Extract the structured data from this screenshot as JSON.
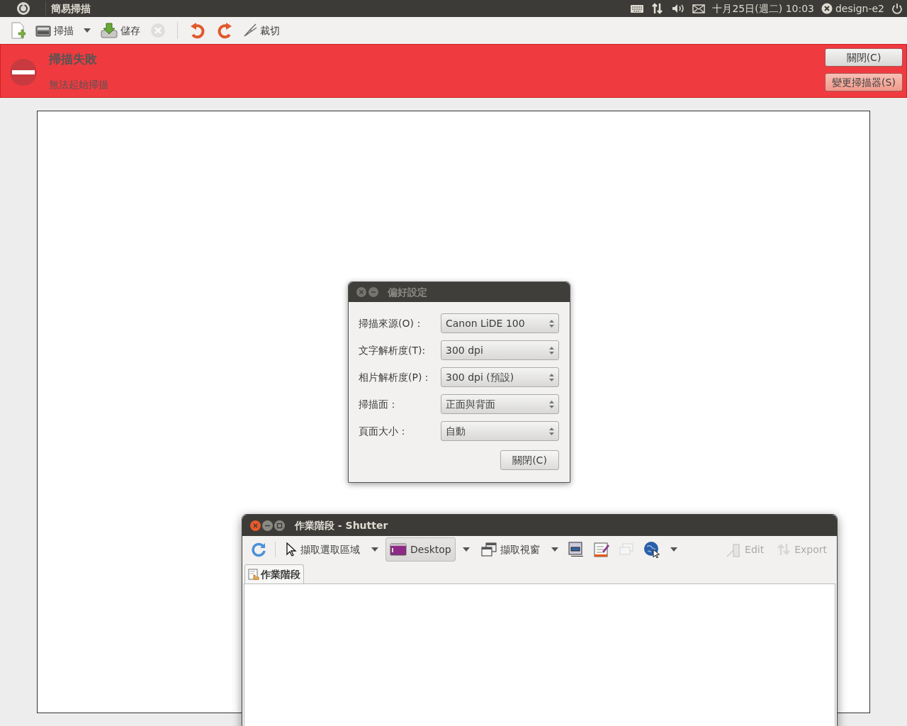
{
  "top_panel": {
    "app_title": "簡易掃描",
    "clock": "十月25日(週二) 10:03",
    "user": "design-e2"
  },
  "toolbar": [
    {
      "kind": "new",
      "disabled": false
    },
    {
      "kind": "scan",
      "label": "掃描",
      "dropdown": true,
      "disabled": false
    },
    {
      "kind": "save",
      "label": "儲存",
      "disabled": false
    },
    {
      "kind": "stop",
      "disabled": true
    },
    {
      "kind": "separator"
    },
    {
      "kind": "rotate-left",
      "disabled": false
    },
    {
      "kind": "rotate-right",
      "disabled": false
    },
    {
      "kind": "crop",
      "label": "裁切",
      "disabled": false
    }
  ],
  "info_bar": {
    "title": "掃描失敗",
    "message": "無法起始掃描",
    "buttons": [
      "關閉(C)",
      "變更掃描器(S)"
    ]
  },
  "preferences_dialog": {
    "title": "偏好設定",
    "rows": [
      {
        "label": "掃描來源(O)：",
        "value": "Canon LiDE 100"
      },
      {
        "label": "文字解析度(T):",
        "value": "300 dpi"
      },
      {
        "label": "相片解析度(P)：",
        "value": "300 dpi (預設)"
      },
      {
        "label": "掃描面：",
        "value": "正面與背面"
      },
      {
        "label": "頁面大小：",
        "value": "自動"
      }
    ],
    "close_button": "關閉(C)"
  },
  "shutter_window": {
    "title": "作業階段 - Shutter",
    "toolbar": [
      {
        "kind": "refresh",
        "disabled": false
      },
      {
        "kind": "separator"
      },
      {
        "kind": "selection",
        "label": "擷取選取區域",
        "dropdown": true,
        "selected": false,
        "disabled": false
      },
      {
        "kind": "desktop",
        "label": "Desktop",
        "dropdown": true,
        "selected": true,
        "disabled": false
      },
      {
        "kind": "window",
        "label": "擷取視窗",
        "dropdown": true,
        "selected": false,
        "disabled": false
      },
      {
        "kind": "section",
        "selected": false,
        "disabled": false
      },
      {
        "kind": "editor",
        "selected": false,
        "disabled": false
      },
      {
        "kind": "menu",
        "selected": false,
        "disabled": true
      },
      {
        "kind": "web",
        "dropdown": true,
        "selected": false,
        "disabled": false
      },
      {
        "kind": "spacer"
      },
      {
        "kind": "edit",
        "label": "Edit",
        "selected": false,
        "disabled": true
      },
      {
        "kind": "export",
        "label": "Export",
        "selected": false,
        "disabled": true
      }
    ],
    "tabs": [
      {
        "label": "作業階段",
        "selected": true
      }
    ]
  }
}
